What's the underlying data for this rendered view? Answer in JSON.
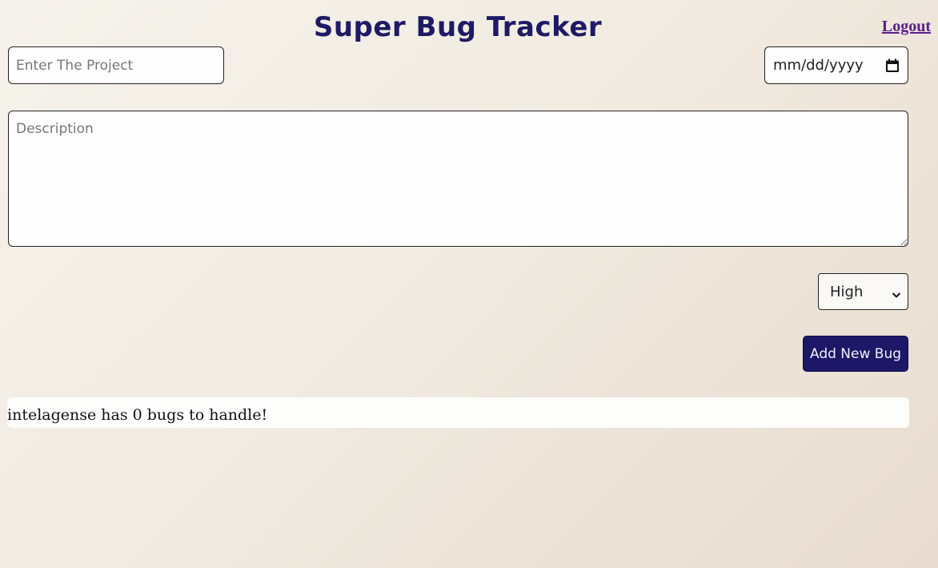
{
  "app": {
    "title": "Super Bug Tracker",
    "logout_label": "Logout"
  },
  "form": {
    "project_placeholder": "Enter The Project",
    "project_value": "",
    "date_placeholder": "mm/dd/yyyy",
    "description_placeholder": "Description",
    "description_value": "",
    "priority_selected": "High",
    "add_button_label": "Add New Bug"
  },
  "status": {
    "message": "intelagense has 0 bugs to handle!"
  },
  "icons": {
    "date_picker": "calendar-icon",
    "select_arrow": "chevron-down-icon"
  },
  "colors": {
    "title": "#1e1a66",
    "button_bg": "#1c1766",
    "logout_link": "#5a1c8c"
  }
}
